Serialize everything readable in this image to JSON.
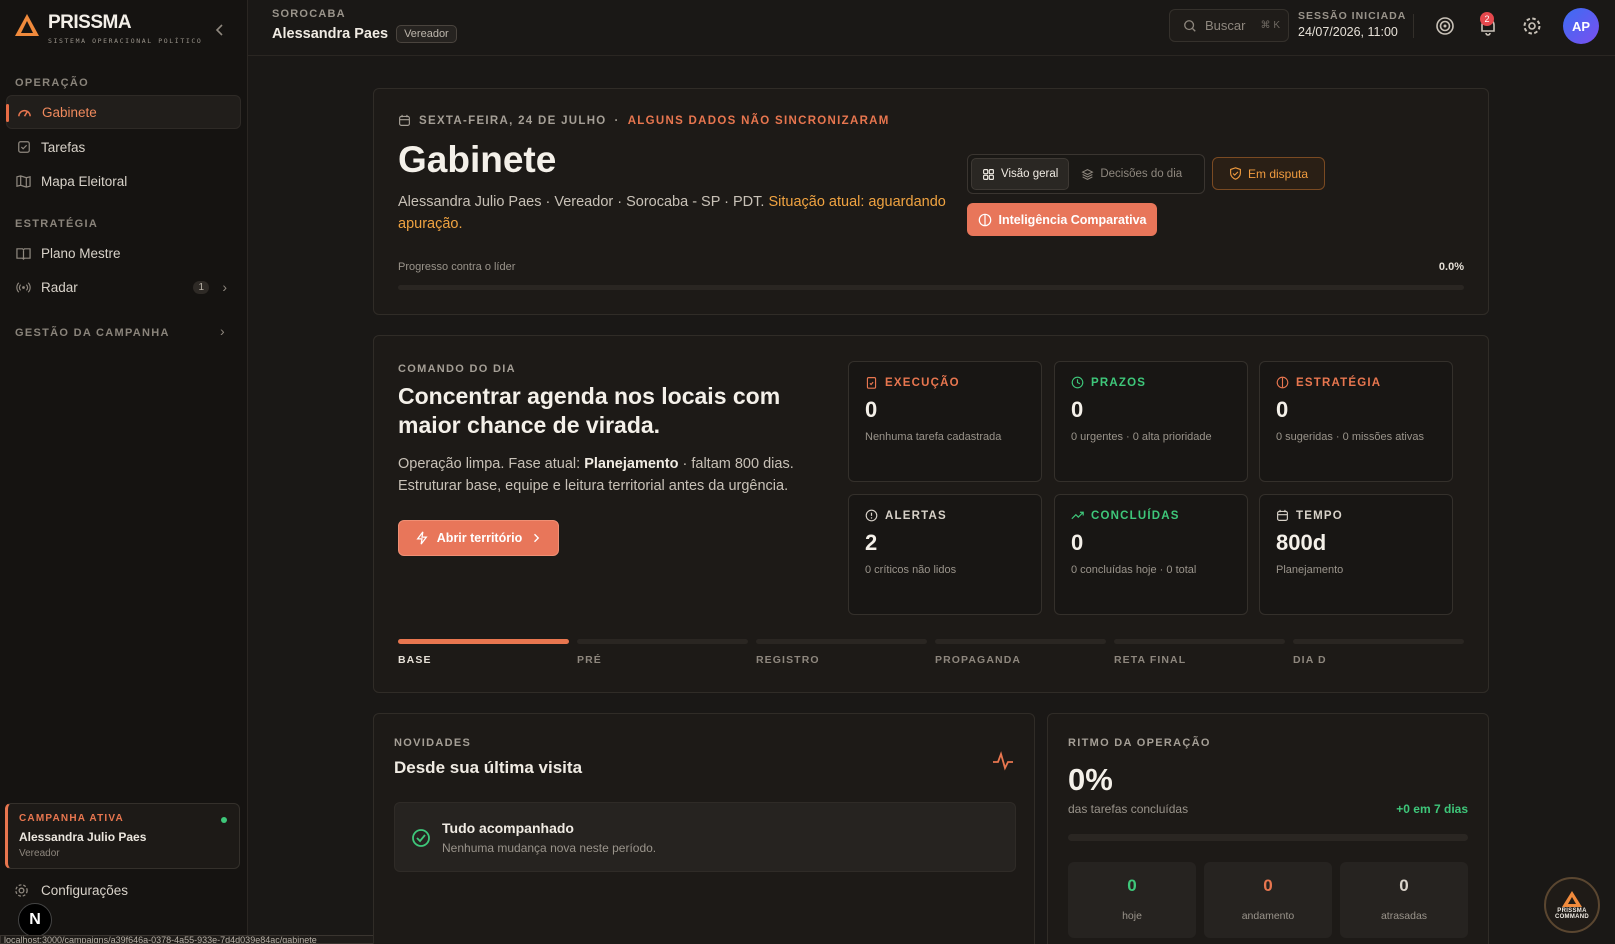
{
  "brand": {
    "name": "PRISSMA",
    "tagline": "SISTEMA OPERACIONAL POLÍTICO"
  },
  "sidebar": {
    "sections": [
      {
        "label": "OPERAÇÃO"
      },
      {
        "label": "ESTRATÉGIA"
      },
      {
        "label": "GESTÃO DA CAMPANHA"
      }
    ],
    "items": [
      {
        "label": "Gabinete"
      },
      {
        "label": "Tarefas"
      },
      {
        "label": "Mapa Eleitoral"
      },
      {
        "label": "Plano Mestre"
      },
      {
        "label": "Radar",
        "badge": "1"
      }
    ],
    "campaign": {
      "label": "CAMPANHA ATIVA",
      "name": "Alessandra Julio Paes",
      "role": "Vereador"
    },
    "settings_label": "Configurações",
    "status_url": "localhost:3000/campaigns/a39f646a-0378-4a55-933e-7d4d039e84ac/gabinete"
  },
  "topbar": {
    "city": "SOROCABA",
    "name": "Alessandra Paes",
    "role": "Vereador",
    "search_placeholder": "Buscar",
    "search_shortcut": "⌘ K",
    "session_label": "SESSÃO INICIADA",
    "session_time": "24/07/2026, 11:00",
    "notifications": "2",
    "avatar": "AP"
  },
  "hero": {
    "date": "SEXTA-FEIRA, 24 DE JULHO",
    "separator": "·",
    "warning": "ALGUNS DADOS NÃO SINCRONIZARAM",
    "title": "Gabinete",
    "subtitle": "Alessandra Julio Paes · Vereador · Sorocaba - SP · PDT.",
    "status": "Situação atual: aguardando apuração.",
    "tab_overview": "Visão geral",
    "tab_decisions": "Decisões do dia",
    "dispute": "Em disputa",
    "intel": "Inteligência Comparativa",
    "progress_label": "Progresso contra o líder",
    "progress_value": "0.0%",
    "progress_fraction": 0
  },
  "command": {
    "label": "COMANDO DO DIA",
    "title": "Concentrar agenda nos locais com maior chance de virada.",
    "desc_prefix": "Operação limpa. Fase atual: ",
    "phase": "Planejamento",
    "desc_suffix": " · faltam 800 dias. Estruturar base, equipe e leitura territorial antes da urgência.",
    "button": "Abrir território",
    "stats": [
      {
        "title": "EXECUÇÃO",
        "value": "0",
        "sub": "Nenhuma tarefa cadastrada",
        "color": "#e8764f"
      },
      {
        "title": "PRAZOS",
        "value": "0",
        "sub": "0 urgentes · 0 alta prioridade",
        "color": "#3ec77a"
      },
      {
        "title": "ESTRATÉGIA",
        "value": "0",
        "sub": "0 sugeridas · 0 missões ativas",
        "color": "#e8764f"
      },
      {
        "title": "ALERTAS",
        "value": "2",
        "sub": "0 críticos não lidos",
        "color": "#d8d2c9"
      },
      {
        "title": "CONCLUÍDAS",
        "value": "0",
        "sub": "0 concluídas hoje · 0 total",
        "color": "#3ec77a"
      },
      {
        "title": "TEMPO",
        "value": "800d",
        "sub": "Planejamento",
        "color": "#d8d2c9"
      }
    ],
    "phases": [
      "BASE",
      "PRÉ",
      "REGISTRO",
      "PROPAGANDA",
      "RETA FINAL",
      "DIA D"
    ]
  },
  "news": {
    "label": "NOVIDADES",
    "title": "Desde sua última visita",
    "item_title": "Tudo acompanhado",
    "item_sub": "Nenhuma mudança nova neste período."
  },
  "rhythm": {
    "label": "RITMO DA OPERAÇÃO",
    "value": "0%",
    "sub": "das tarefas concluídas",
    "delta": "+0 em 7 dias",
    "boxes": [
      {
        "value": "0",
        "label": "hoje",
        "color": "#3ec77a"
      },
      {
        "value": "0",
        "label": "andamento",
        "color": "#e8764f"
      },
      {
        "value": "0",
        "label": "atrasadas",
        "color": "#d8d2c9"
      }
    ]
  },
  "fab": {
    "line1": "PRISSMA",
    "line2": "COMMAND"
  },
  "colors": {
    "accent": "#e8764f",
    "success": "#3ec77a",
    "warning": "#f0a341",
    "bg": "#1a1816"
  }
}
